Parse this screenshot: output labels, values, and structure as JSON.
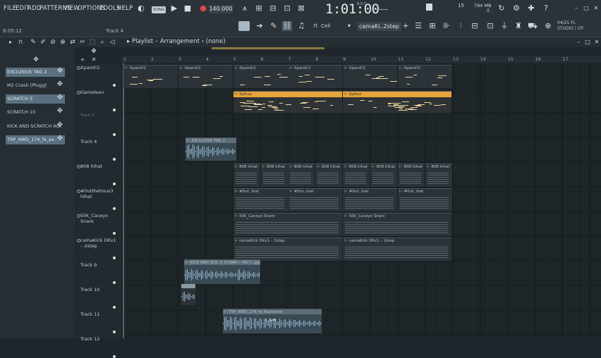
{
  "menu": [
    "FILE",
    "EDIT",
    "ADD",
    "PATTERNS",
    "VIEW",
    "OPTIONS",
    "TOOLS",
    "HELP"
  ],
  "transport": {
    "song_mode": "SONG",
    "tempo": "140.000",
    "big_time": "1:01:00",
    "big_time_unit": "B:S:T",
    "small_time": "6:05:12",
    "track_hint": "Track 4",
    "cpu_num": "15",
    "ram": "794 MB",
    "ram_sub": "0",
    "fl_version": "04/25  FL",
    "fl_studio": "STUDIO | CP..",
    "cell_label": "Cell",
    "pattern_name": "camaKi..2step"
  },
  "playlist": {
    "breadcrumb_playlist": "Playlist",
    "breadcrumb_arrangement": "Arrangement",
    "breadcrumb_pattern": "(none)"
  },
  "picker": [
    {
      "label": "EXCLUSIVE TAG 2",
      "selected": true
    },
    {
      "label": "M2 Crash [Plugg]",
      "selected": false
    },
    {
      "label": "SCRATCH 3",
      "selected": true
    },
    {
      "label": "SCRATCH 10",
      "selected": false
    },
    {
      "label": "KICK AND SCRATCH AG..",
      "selected": false
    },
    {
      "label": "TSP_4WD_174_fx_ex..",
      "selected": true
    }
  ],
  "bars": [
    "1",
    "2",
    "3",
    "4",
    "5",
    "6",
    "7",
    "8",
    "9",
    "10",
    "11",
    "12",
    "13",
    "14",
    "15",
    "16",
    "17"
  ],
  "tracks": [
    {
      "name": "Xpand!2"
    },
    {
      "name": "Gamelean"
    },
    {
      "name": "Track 3"
    },
    {
      "name": "Track 4"
    },
    {
      "name": "808 hihat"
    },
    {
      "name": "#0utthehous3 hihat"
    },
    {
      "name": "50k_Caceyo Snare"
    },
    {
      "name": "camaKick DKv1 – 2step"
    },
    {
      "name": "Track 9"
    },
    {
      "name": "Track 10"
    },
    {
      "name": "Track 11"
    },
    {
      "name": "Track 12"
    }
  ],
  "clips": {
    "xpand": "Xpand!2",
    "sytrus": "Sytrus",
    "excl": "EXCLUSIVE TAG 2",
    "hihat808": "808 hihat",
    "outhihat": "#0ut..ihat",
    "snare": "50k_Caceyo Snare",
    "kick": "camaKick DKv1 – 2step",
    "kickscr": "KICK AND SCR..1 (COMBO)",
    "m2": "M2 C..gg]",
    "tsp": "TSP_4WD_174_fx_Explosive",
    "tsp_db": "1.3dB"
  },
  "colors": {
    "accent": "#e8a438",
    "selected": "#5a7080",
    "audio": "#9fc0d8"
  }
}
